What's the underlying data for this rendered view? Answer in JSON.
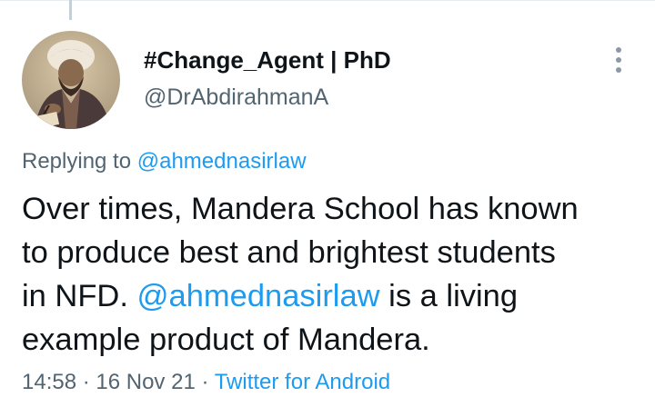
{
  "author": {
    "display_name": "#Change_Agent | PhD",
    "handle": "@DrAbdirahmanA"
  },
  "reply": {
    "prefix": "Replying to ",
    "handle": "@ahmednasirlaw"
  },
  "tweet": {
    "line1": "Over times, Mandera School has known",
    "line2": "to produce best and brightest students",
    "line3_before": "in NFD. ",
    "line3_mention": "@ahmednasirlaw",
    "line3_after": " is a living",
    "line4": "example product of Mandera."
  },
  "meta": {
    "time": "14:58",
    "separator1": " · ",
    "date": "16 Nov 21",
    "separator2": " · ",
    "source": "Twitter for Android"
  },
  "colors": {
    "link": "#1d9bf0",
    "text": "#0f1419",
    "secondary": "#536471"
  },
  "icons": {
    "more": "more-vertical-icon"
  }
}
